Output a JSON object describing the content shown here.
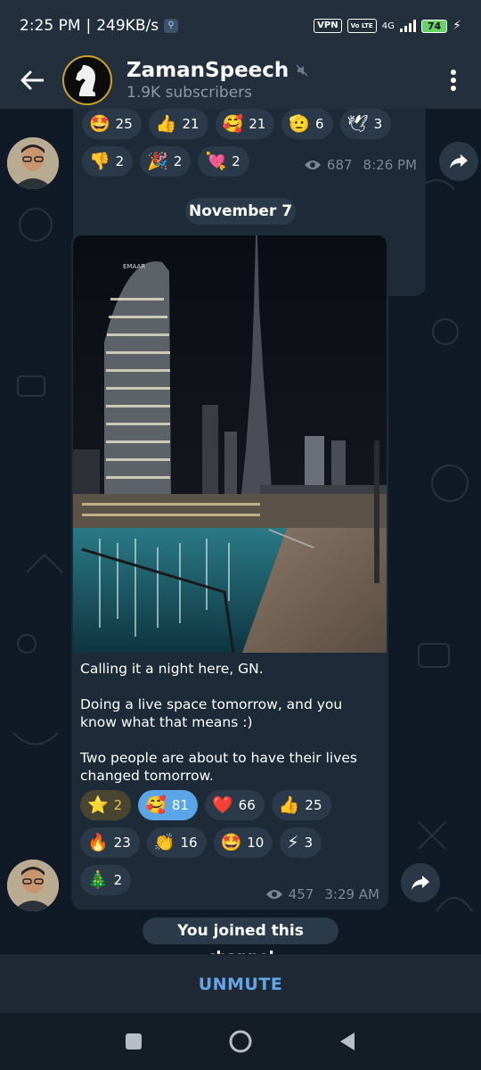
{
  "status_bar": {
    "time": "2:25 PM",
    "speed": "249KB/s",
    "vpn": "VPN",
    "volte": "Vo LTE",
    "network": "4G",
    "battery": "74"
  },
  "header": {
    "title": "ZamanSpeech",
    "subtitle": "1.9K subscribers",
    "muted_icon": "muted-speaker-icon"
  },
  "message_1": {
    "reactions": [
      {
        "emoji": "🤩",
        "count": "25"
      },
      {
        "emoji": "👍",
        "count": "21"
      },
      {
        "emoji": "🥰",
        "count": "21"
      },
      {
        "emoji": "🫡",
        "count": "6"
      },
      {
        "emoji": "🕊",
        "count": "3"
      },
      {
        "emoji": "👎",
        "count": "2"
      },
      {
        "emoji": "🎉",
        "count": "2"
      },
      {
        "emoji": "💘",
        "count": "2"
      }
    ],
    "views": "687",
    "time": "8:26 PM"
  },
  "date_separator": "November 7",
  "message_2": {
    "photo_sign": "EMAAR",
    "caption": [
      "Calling it a night here, GN.",
      "Doing a live space tomorrow, and you know what that means :)",
      "Two people are about to have their lives changed tomorrow."
    ],
    "reactions": [
      {
        "emoji": "⭐",
        "count": "2",
        "style": "gold"
      },
      {
        "emoji": "🥰",
        "count": "81",
        "style": "active"
      },
      {
        "emoji": "❤️",
        "count": "66"
      },
      {
        "emoji": "👍",
        "count": "25"
      },
      {
        "emoji": "🔥",
        "count": "23"
      },
      {
        "emoji": "👏",
        "count": "16"
      },
      {
        "emoji": "🤩",
        "count": "10"
      },
      {
        "emoji": "⚡",
        "count": "3"
      },
      {
        "emoji": "🎄",
        "count": "2"
      }
    ],
    "views": "457",
    "time": "3:29 AM"
  },
  "service_message": "You joined this channel",
  "bottom_action": "UNMUTE",
  "colors": {
    "header_bg": "#242f3d",
    "chat_bg": "#0f1a26",
    "bubble_bg": "#1d2a38",
    "accent": "#62a6e8",
    "active_reaction": "#5aa5e8"
  }
}
